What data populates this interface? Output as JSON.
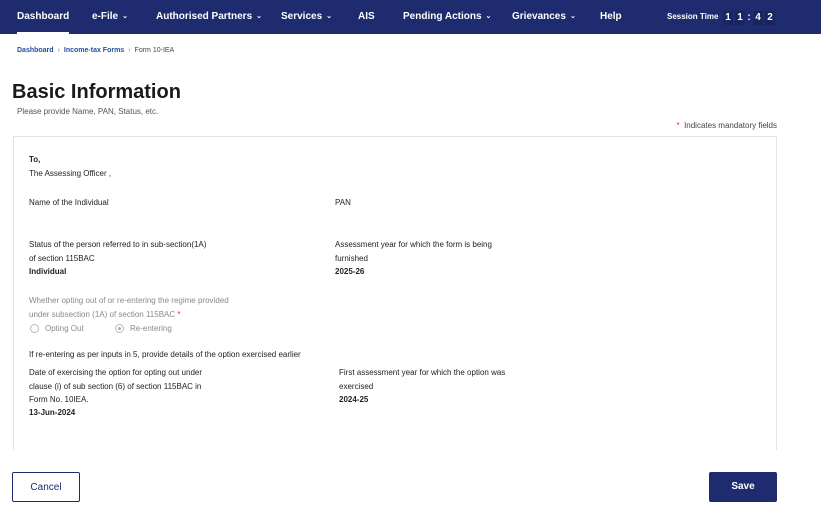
{
  "nav": {
    "items": [
      {
        "label": "Dashboard"
      },
      {
        "label": "e-File"
      },
      {
        "label": "Authorised Partners"
      },
      {
        "label": "Services"
      },
      {
        "label": "AIS"
      },
      {
        "label": "Pending Actions"
      },
      {
        "label": "Grievances"
      },
      {
        "label": "Help"
      }
    ],
    "session_label": "Session Time",
    "session_digits": [
      "1",
      "1",
      ":",
      "4",
      "2"
    ],
    "chevron": "⌄"
  },
  "breadcrumb": {
    "items": [
      "Dashboard",
      "Income-tax Forms",
      "Form 10-IEA"
    ],
    "separator": "›"
  },
  "page": {
    "title": "Basic Information",
    "subtitle": "Please provide Name, PAN, Status, etc.",
    "mandatory_star": "*",
    "mandatory_note": "Indicates mandatory fields"
  },
  "form": {
    "to_label": "To,",
    "to_value": "The Assessing Officer ,",
    "name_label": "Name of the Individual",
    "pan_label": "PAN",
    "status_label_line1": "Status of the person referred to in sub-section(1A)",
    "status_label_line2": "of section 115BAC",
    "status_value": "Individual",
    "ay_label_line1": "Assessment year for which the form is being",
    "ay_label_line2": "furnished",
    "ay_value": "2025-26",
    "opting_label_line1": "Whether opting out of or re-entering the regime provided",
    "opting_label_line2": "under subsection (1A) of section 115BAC",
    "opting_star": "*",
    "option_out": "Opting Out",
    "option_re": "Re-entering",
    "selected_option": "Re-entering",
    "reentering_note": "If re-entering as per inputs in 5, provide details of the option exercised earlier",
    "date_label_line1": "Date of exercising the option for opting out under",
    "date_label_line2": "clause (i) of sub section (6) of section 115BAC in",
    "date_label_line3": "Form No. 10IEA.",
    "date_value": "13-Jun-2024",
    "first_ay_label_line1": "First assessment year for which the option was",
    "first_ay_label_line2": "exercised",
    "first_ay_value": "2024-25"
  },
  "actions": {
    "cancel_label": "Cancel",
    "save_label": "Save"
  }
}
